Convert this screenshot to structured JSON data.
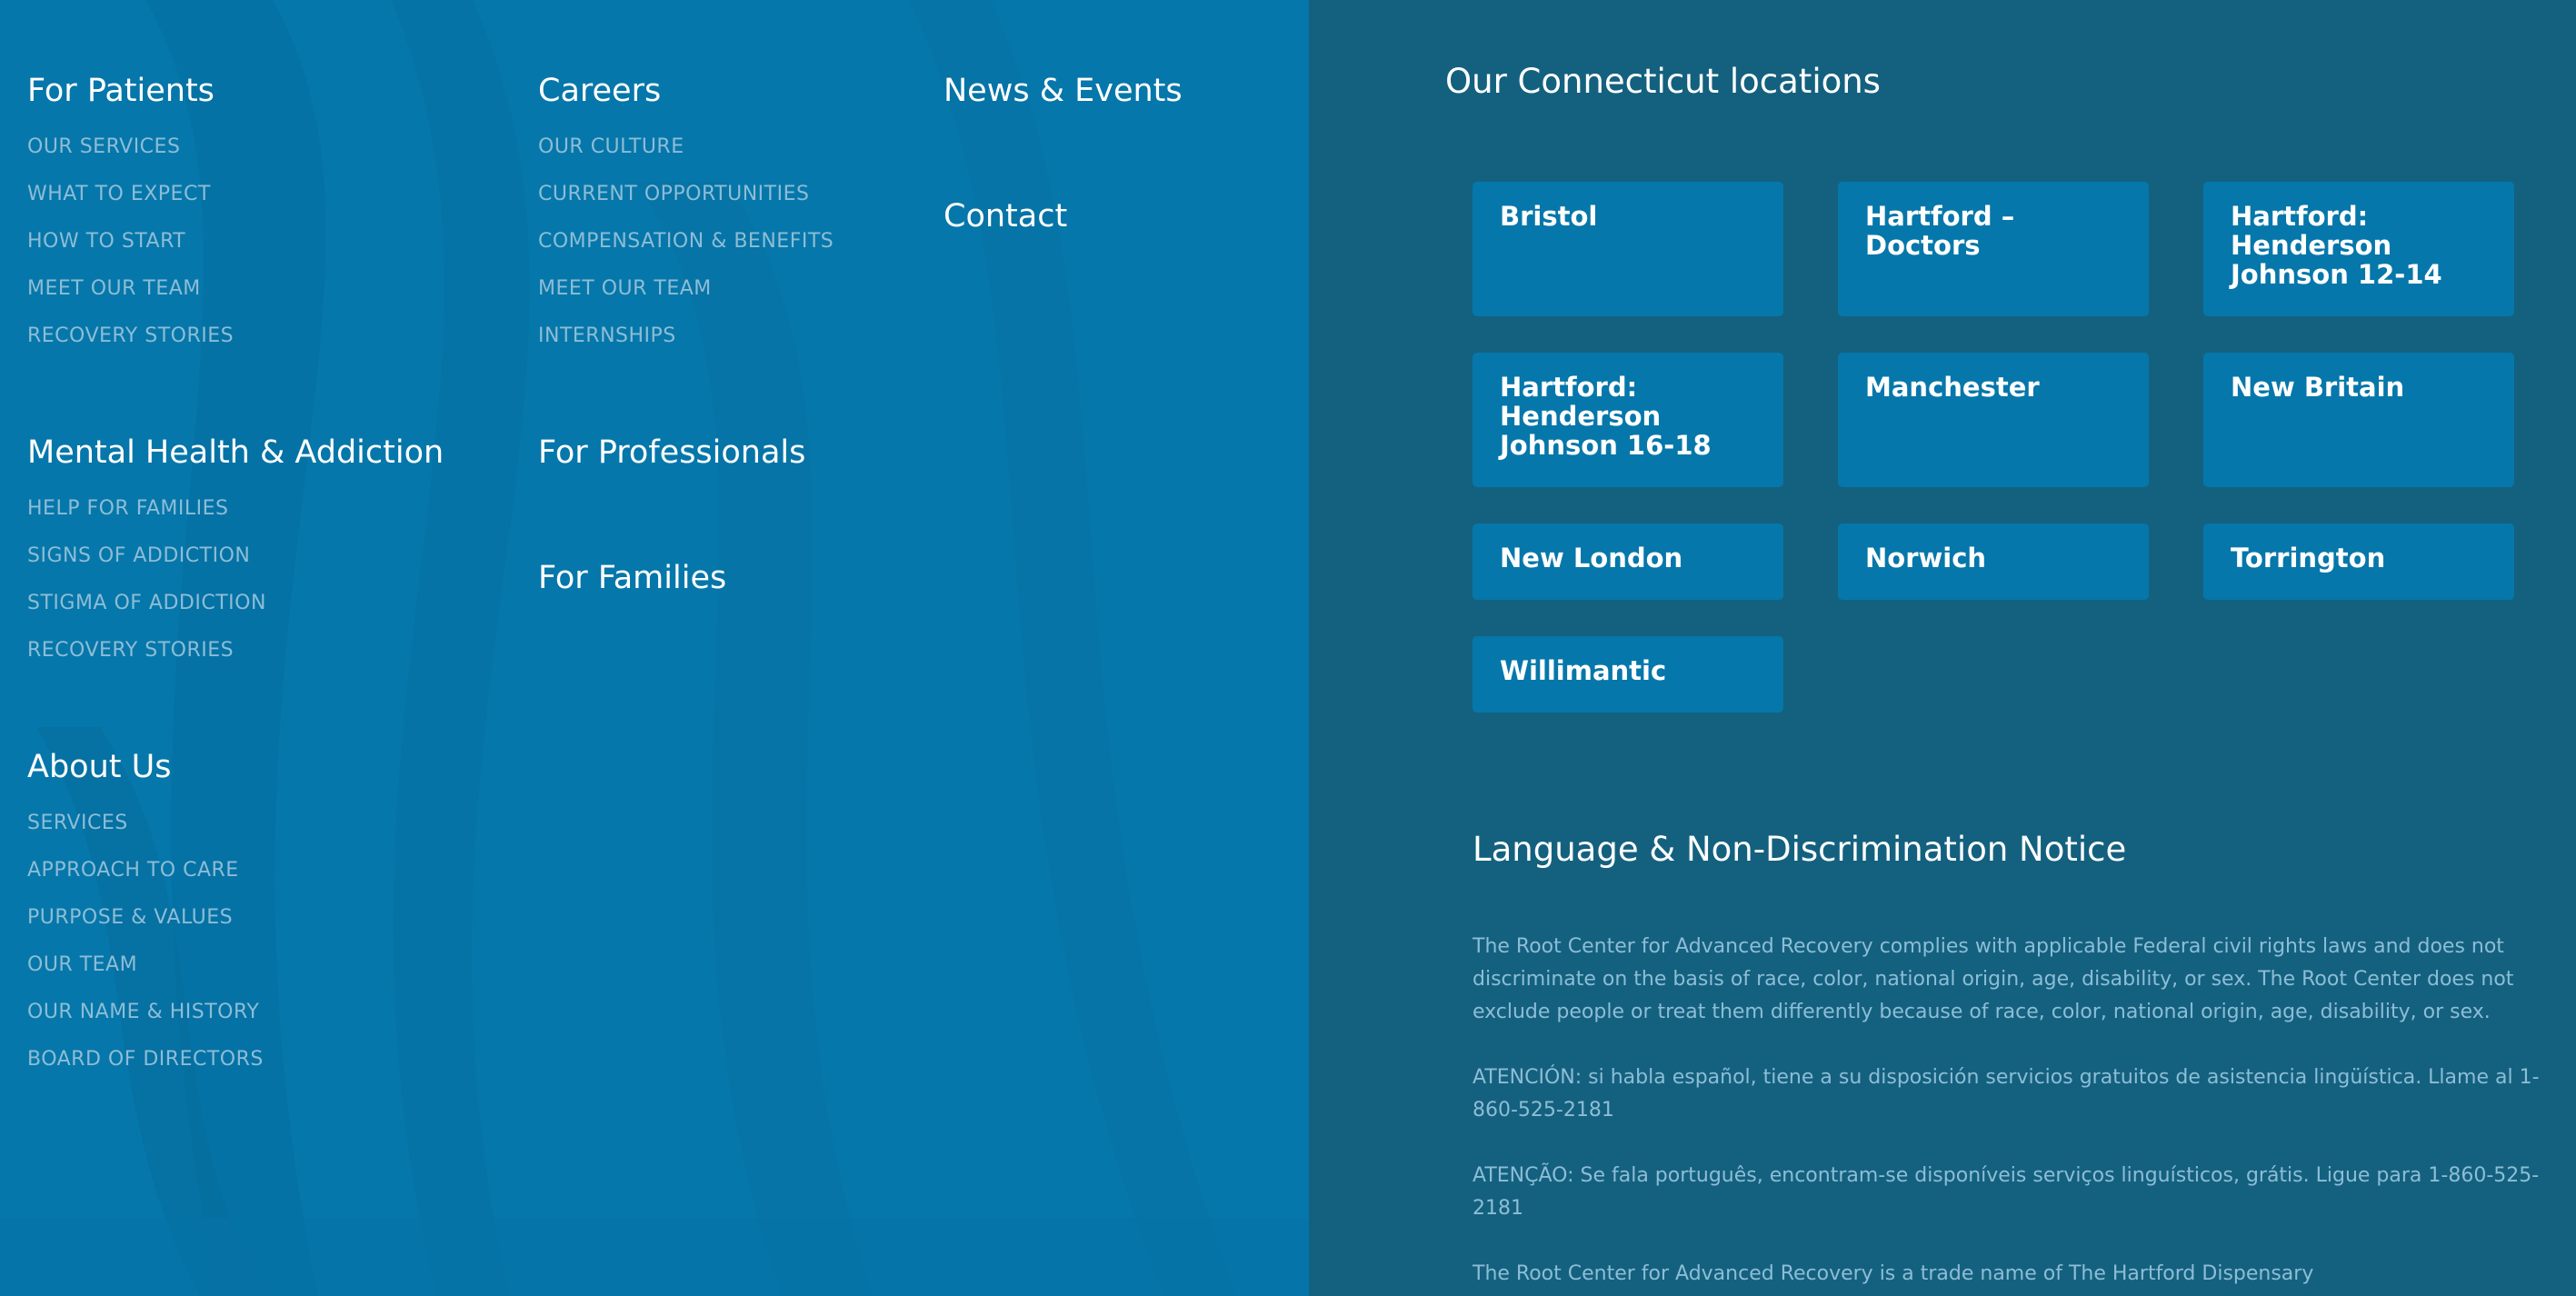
{
  "nav": {
    "patients": {
      "title": "For Patients",
      "links": [
        "OUR SERVICES",
        "WHAT TO EXPECT",
        "HOW TO START",
        "MEET OUR TEAM",
        "RECOVERY STORIES"
      ]
    },
    "mental_health": {
      "title": "Mental Health & Addiction",
      "links": [
        "HELP FOR FAMILIES",
        "SIGNS OF ADDICTION",
        "STIGMA OF ADDICTION",
        "RECOVERY STORIES"
      ]
    },
    "about": {
      "title": "About Us",
      "links": [
        "SERVICES",
        "APPROACH TO CARE",
        "PURPOSE & VALUES",
        "OUR TEAM",
        "OUR NAME & HISTORY",
        "BOARD OF DIRECTORS"
      ]
    },
    "careers": {
      "title": "Careers",
      "links": [
        "OUR CULTURE",
        "CURRENT OPPORTUNITIES",
        "COMPENSATION & BENEFITS",
        "MEET OUR TEAM",
        "INTERNSHIPS"
      ]
    },
    "professionals": {
      "title": "For Professionals"
    },
    "families": {
      "title": "For Families"
    },
    "news": {
      "title": "News & Events"
    },
    "contact": {
      "title": "Contact"
    }
  },
  "locations": {
    "title": "Our Connecticut locations",
    "items": [
      "Bristol",
      "Hartford – Doctors",
      "Hartford: Henderson Johnson 12-14",
      "Hartford: Henderson Johnson 16-18",
      "Manchester",
      "New Britain",
      "New London",
      "Norwich",
      "Torrington",
      "Willimantic"
    ]
  },
  "notice": {
    "title": "Language & Non-Discrimination Notice",
    "paragraphs": [
      "The Root Center for Advanced Recovery complies with applicable Federal civil rights laws and does not discriminate on the basis of race, color, national origin, age, disability, or sex. The Root Center does not exclude people or treat them differently because of race, color, national origin, age, disability, or sex.",
      "ATENCIÓN: si habla español, tiene a su disposición servicios gratuitos de asistencia lingüística. Llame al 1-860-525-2181",
      "ATENÇÃO: Se fala português, encontram-se disponíveis serviços linguísticos, grátis. Ligue para 1-860-525-2181",
      "The Root Center for Advanced Recovery is a trade name of The Hartford Dispensary"
    ]
  },
  "colors": {
    "left_panel": "#0677aa",
    "right_panel": "#14617f",
    "card": "#0677aa",
    "link_text": "#8dbdd6",
    "heading_text": "#ffffff"
  }
}
